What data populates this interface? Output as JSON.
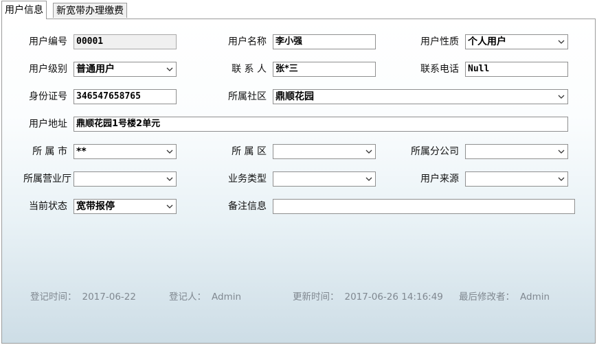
{
  "tabs": [
    "用户信息",
    "新宽带办理缴费"
  ],
  "labels": {
    "user_id": "用户编号",
    "user_name": "用户名称",
    "user_type": "用户性质",
    "user_level": "用户级别",
    "contact": "联 系 人",
    "phone": "联系电话",
    "id_card": "身份证号",
    "community": "所属社区",
    "address": "用户地址",
    "city": "所 属 市",
    "district": "所 属 区",
    "branch": "所属分公司",
    "hall": "所属营业厅",
    "business_type": "业务类型",
    "source": "用户来源",
    "status": "当前状态",
    "remark": "备注信息"
  },
  "values": {
    "user_id": "00001",
    "user_name": "李小强",
    "user_type": "个人用户",
    "user_level": "普通用户",
    "contact": "张*三",
    "phone": "Null",
    "id_card": "346547658765",
    "community": "鼎顺花园",
    "address": "鼎顺花园1号楼2单元",
    "city": "**",
    "district": "",
    "branch": "",
    "hall": "",
    "business_type": "",
    "source": "",
    "status": "宽带报停",
    "remark": ""
  },
  "footer": {
    "register_time_label": "登记时间：",
    "register_time": "2017-06-22",
    "register_by_label": "登记人：",
    "register_by": "Admin",
    "update_time_label": "更新时间：",
    "update_time": "2017-06-26 14:16:49",
    "modified_by_label": "最后修改者：",
    "modified_by": "Admin"
  },
  "icons": {
    "dropdown": "chevron-down-icon"
  },
  "colors": {
    "panel_gradient_end": "#cddde6",
    "footer_text": "#808890",
    "readonly_bg": "#f0f0f0"
  }
}
